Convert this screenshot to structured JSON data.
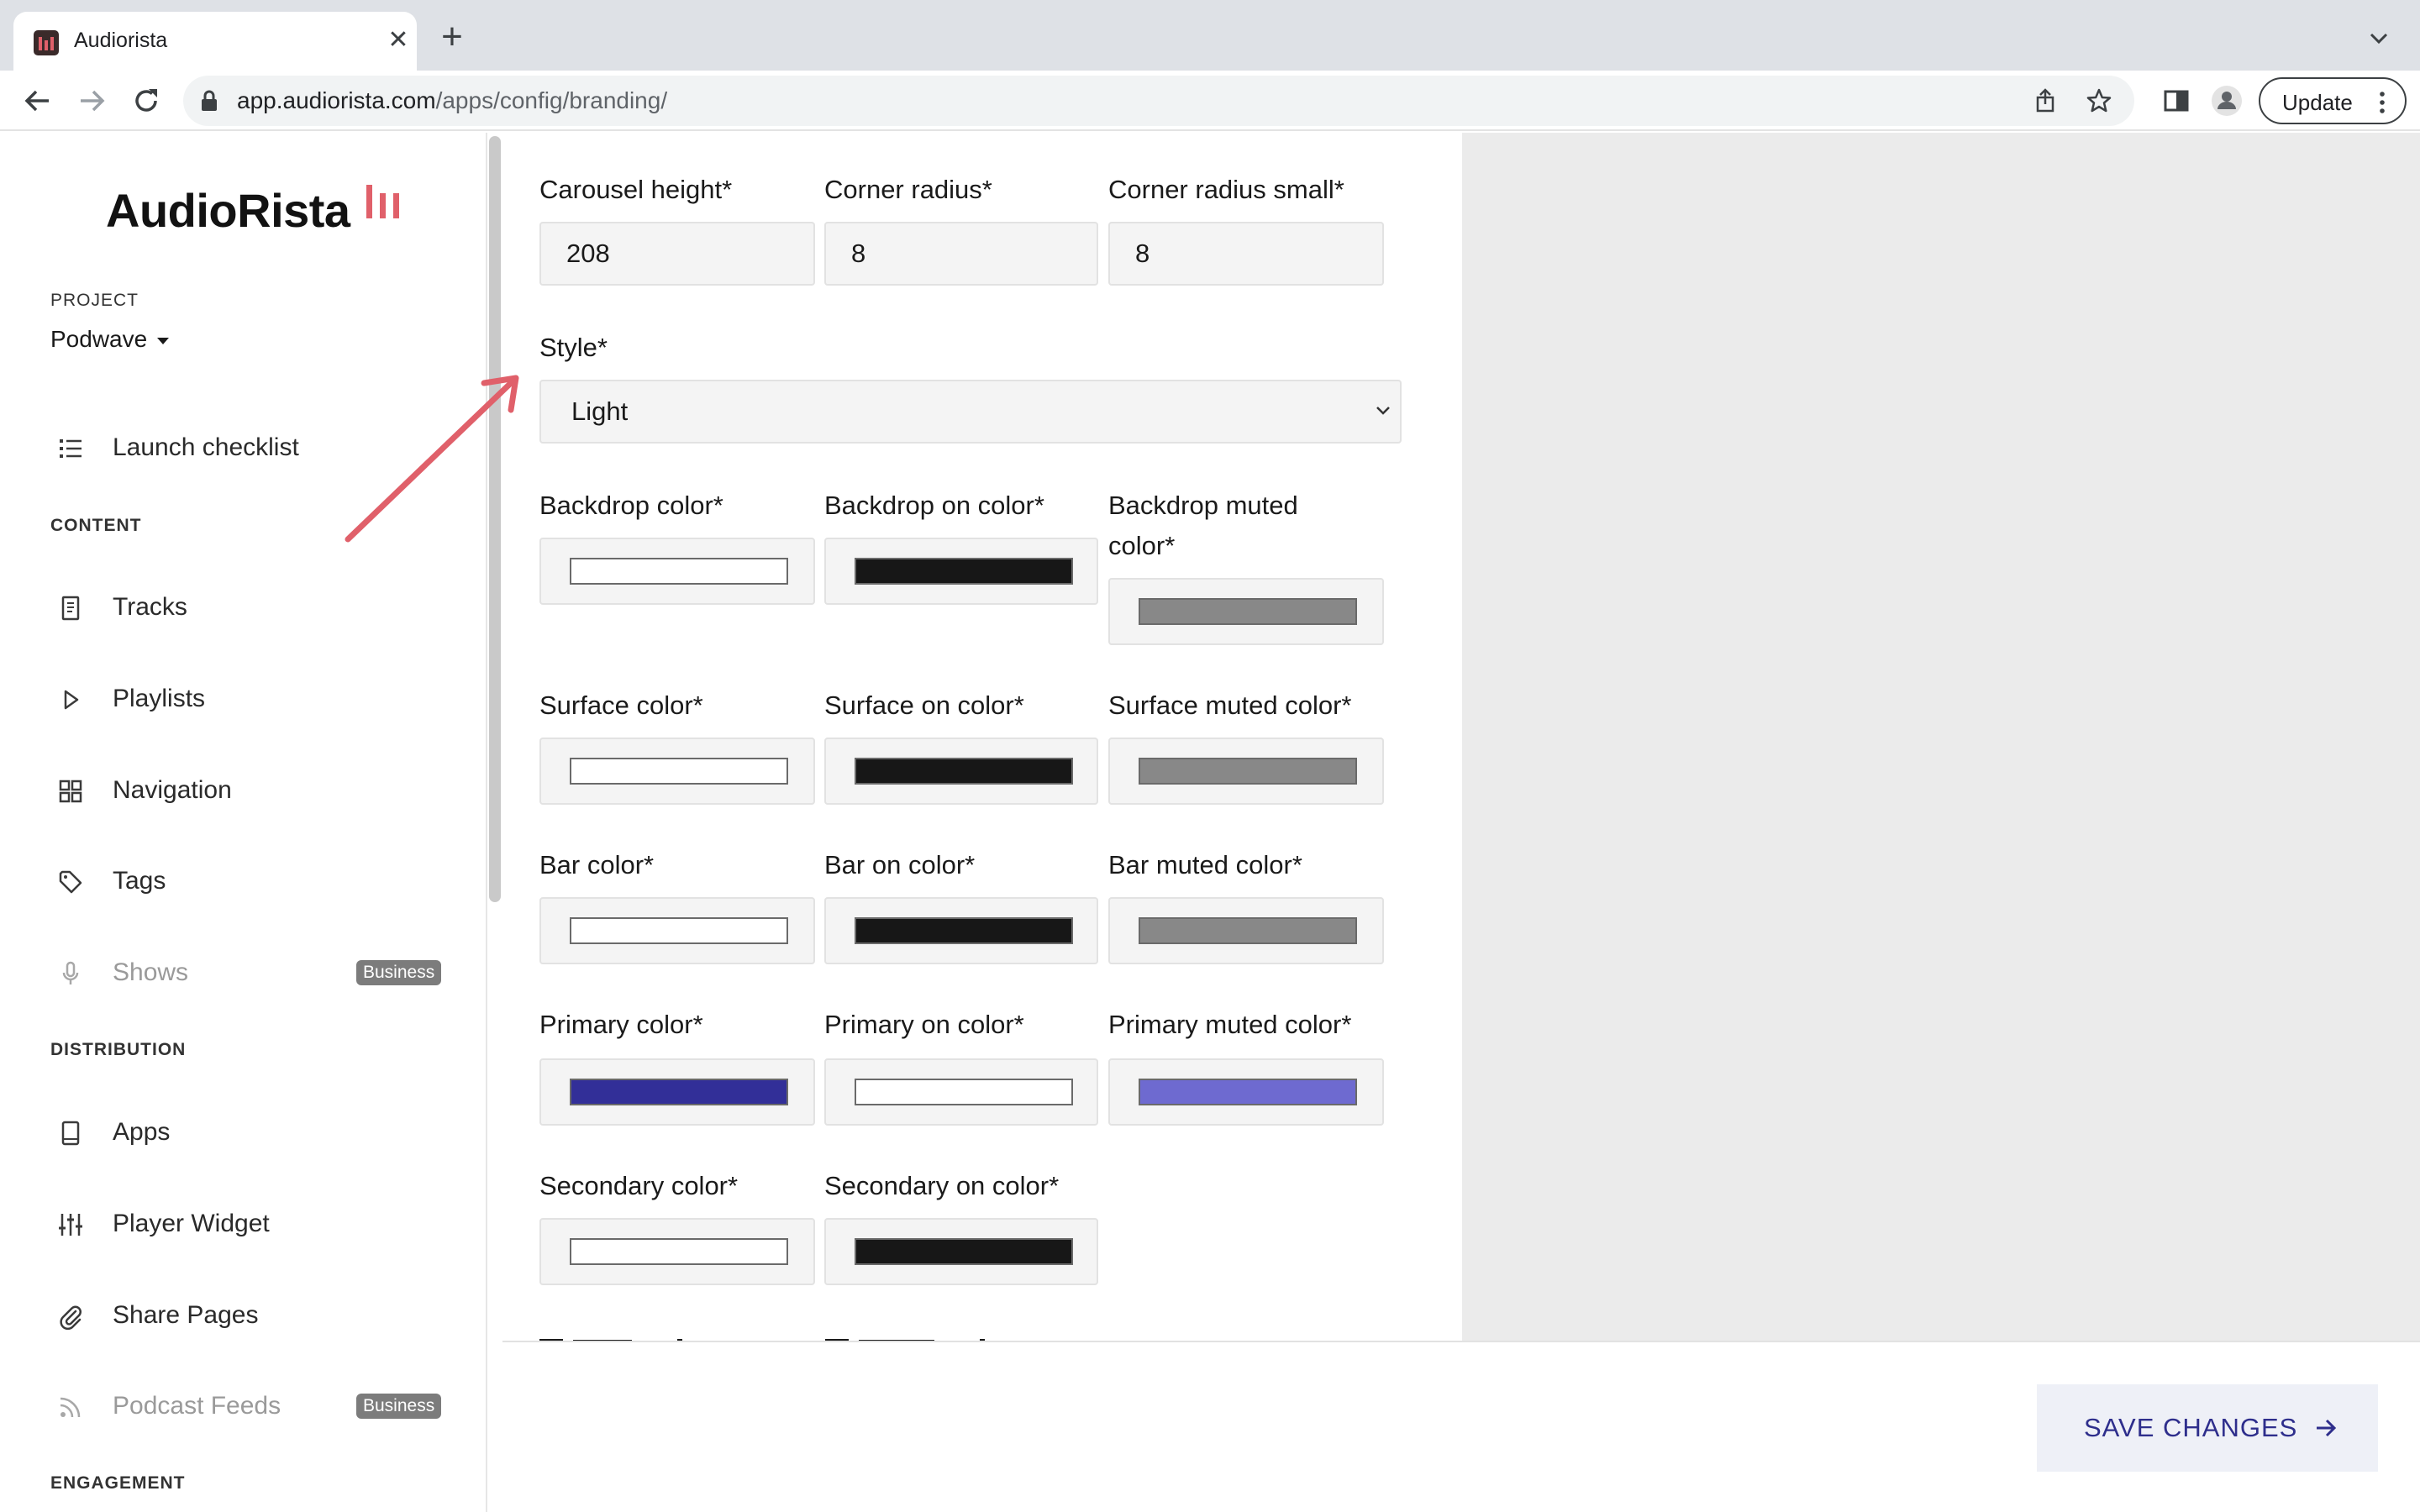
{
  "browser": {
    "tab_title": "Audiorista",
    "url_domain": "app.audiorista.com",
    "url_path": "/apps/config/branding/",
    "update_label": "Update"
  },
  "sidebar": {
    "logo_text": "AudioRista",
    "project_label": "PROJECT",
    "project_name": "Podwave",
    "launch_checklist": "Launch checklist",
    "content_label": "CONTENT",
    "content_items": [
      {
        "label": "Tracks",
        "icon": "document-icon"
      },
      {
        "label": "Playlists",
        "icon": "play-icon"
      },
      {
        "label": "Navigation",
        "icon": "grid-icon"
      },
      {
        "label": "Tags",
        "icon": "tag-icon"
      },
      {
        "label": "Shows",
        "icon": "microphone-icon",
        "badge": "Business",
        "disabled": true
      }
    ],
    "distribution_label": "DISTRIBUTION",
    "distribution_items": [
      {
        "label": "Apps",
        "icon": "tablet-icon"
      },
      {
        "label": "Player Widget",
        "icon": "sliders-icon"
      },
      {
        "label": "Share Pages",
        "icon": "paperclip-icon"
      },
      {
        "label": "Podcast Feeds",
        "icon": "rss-icon",
        "badge": "Business",
        "disabled": true
      }
    ],
    "engagement_label": "ENGAGEMENT"
  },
  "form": {
    "carousel_height": {
      "label": "Carousel height*",
      "value": "208"
    },
    "corner_radius": {
      "label": "Corner radius*",
      "value": "8"
    },
    "corner_radius_small": {
      "label": "Corner radius small*",
      "value": "8"
    },
    "style": {
      "label": "Style*",
      "value": "Light"
    },
    "colors": {
      "backdrop": {
        "label": "Backdrop color*",
        "color": "#ffffff"
      },
      "backdrop_on": {
        "label": "Backdrop on color*",
        "color": "#171717"
      },
      "backdrop_muted": {
        "label_line1": "Backdrop muted",
        "label_line2": "color*",
        "color": "#888888"
      },
      "surface": {
        "label": "Surface color*",
        "color": "#ffffff"
      },
      "surface_on": {
        "label": "Surface on color*",
        "color": "#171717"
      },
      "surface_muted": {
        "label": "Surface muted color*",
        "color": "#888888"
      },
      "bar": {
        "label": "Bar color*",
        "color": "#ffffff"
      },
      "bar_on": {
        "label": "Bar on color*",
        "color": "#171717"
      },
      "bar_muted": {
        "label": "Bar muted color*",
        "color": "#888888"
      },
      "primary": {
        "label": "Primary color*",
        "color": "#322f98"
      },
      "primary_on": {
        "label": "Primary on color*",
        "color": "#ffffff"
      },
      "primary_muted": {
        "label": "Primary muted color*",
        "color": "#6e6ad0"
      },
      "secondary": {
        "label": "Secondary color*",
        "color": "#ffffff"
      },
      "secondary_on": {
        "label": "Secondary on color*",
        "color": "#171717"
      }
    }
  },
  "footer": {
    "save_label": "SAVE CHANGES"
  },
  "theme": {
    "accent": "#e0606a",
    "save_text": "#2e2e8c"
  }
}
